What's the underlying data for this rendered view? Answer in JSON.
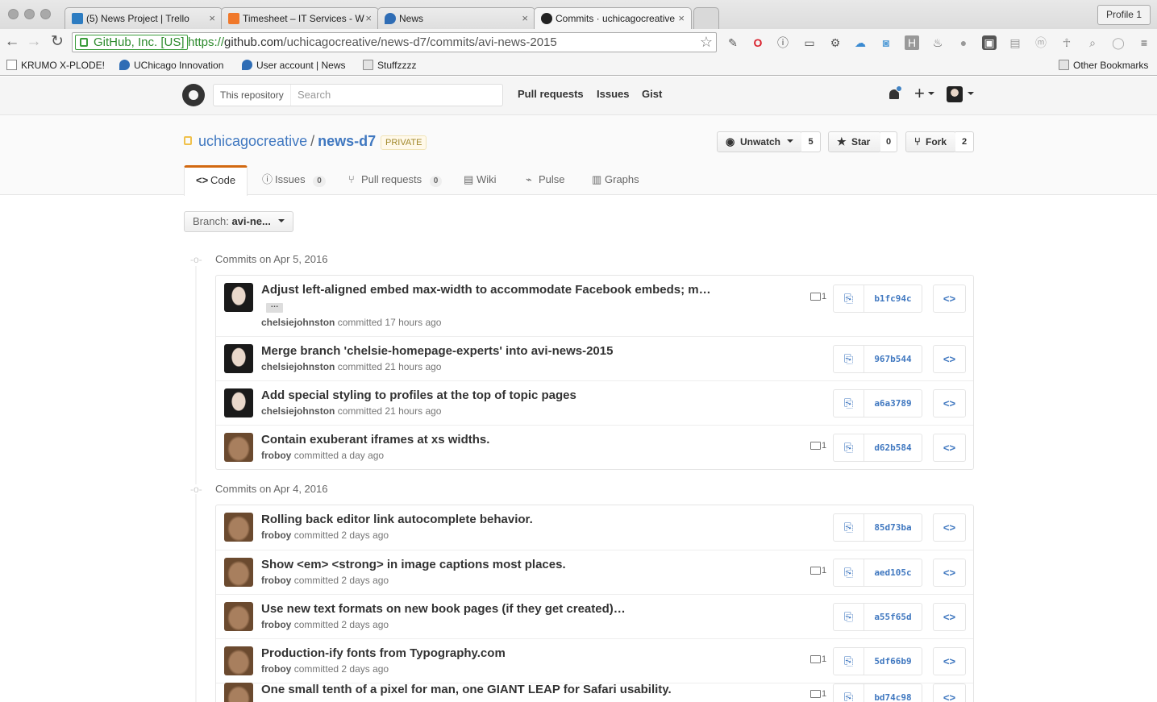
{
  "browser": {
    "tabs": [
      {
        "title": "(5) News Project | Trello",
        "favicon_color": "#2d7cc1",
        "active": false
      },
      {
        "title": "Timesheet – IT Services - W",
        "favicon_color": "#f0782a",
        "active": false
      },
      {
        "title": "News",
        "favicon_color": "#2f6db5",
        "active": false
      },
      {
        "title": "Commits · uchicagocreative",
        "favicon_color": "#222222",
        "active": true
      }
    ],
    "close_glyph": "×",
    "profile_label": "Profile 1",
    "ssl_label": "GitHub, Inc. [US]",
    "url_scheme": "https://",
    "url_host": "github.com",
    "url_path": "/uchicagocreative/news-d7/commits/avi-news-2015",
    "bookmarks": [
      "KRUMO X-PLODE!",
      "UChicago Innovation",
      "User account | News",
      "Stuffzzzz"
    ],
    "other_bookmarks": "Other Bookmarks"
  },
  "header": {
    "search_scope": "This repository",
    "search_placeholder": "Search",
    "nav": [
      "Pull requests",
      "Issues",
      "Gist"
    ]
  },
  "repo": {
    "owner": "uchicagocreative",
    "separator": "/",
    "name": "news-d7",
    "visibility": "PRIVATE",
    "unwatch_label": "Unwatch",
    "watch_count": "5",
    "star_label": "Star",
    "star_count": "0",
    "fork_label": "Fork",
    "fork_count": "2",
    "tabs": [
      {
        "label": "Code",
        "icon": "code-icon"
      },
      {
        "label": "Issues",
        "count": "0",
        "icon": "issue-icon"
      },
      {
        "label": "Pull requests",
        "count": "0",
        "icon": "pull-request-icon"
      },
      {
        "label": "Wiki",
        "icon": "book-icon"
      },
      {
        "label": "Pulse",
        "icon": "pulse-icon"
      },
      {
        "label": "Graphs",
        "icon": "graph-icon"
      }
    ],
    "branch_prefix": "Branch:",
    "branch_name": "avi-ne..."
  },
  "commit_groups": [
    {
      "date_label": "Commits on Apr 5, 2016",
      "commits": [
        {
          "title": "Adjust left-aligned embed max-width to accommodate Facebook embeds; m…",
          "author": "chelsiejohnston",
          "verb": "committed",
          "time": "17 hours ago",
          "comments": "1",
          "sha": "b1fc94c",
          "expand": "…"
        },
        {
          "title": "Merge branch 'chelsie-homepage-experts' into avi-news-2015",
          "author": "chelsiejohnston",
          "verb": "committed",
          "time": "21 hours ago",
          "comments": "",
          "sha": "967b544"
        },
        {
          "title": "Add special styling to profiles at the top of topic pages",
          "author": "chelsiejohnston",
          "verb": "committed",
          "time": "21 hours ago",
          "comments": "",
          "sha": "a6a3789"
        },
        {
          "title": "Contain exuberant iframes at xs widths.",
          "author": "froboy",
          "verb": "committed",
          "time": "a day ago",
          "comments": "1",
          "sha": "d62b584"
        }
      ]
    },
    {
      "date_label": "Commits on Apr 4, 2016",
      "commits": [
        {
          "title": "Rolling back editor link autocomplete behavior.",
          "author": "froboy",
          "verb": "committed",
          "time": "2 days ago",
          "comments": "",
          "sha": "85d73ba"
        },
        {
          "title": "Show <em> <strong> in image captions most places.",
          "author": "froboy",
          "verb": "committed",
          "time": "2 days ago",
          "comments": "1",
          "sha": "aed105c"
        },
        {
          "title": "Use new text formats on new book pages (if they get created)…",
          "author": "froboy",
          "verb": "committed",
          "time": "2 days ago",
          "comments": "",
          "sha": "a55f65d"
        },
        {
          "title": "Production-ify fonts from Typography.com",
          "author": "froboy",
          "verb": "committed",
          "time": "2 days ago",
          "comments": "1",
          "sha": "5df66b9"
        },
        {
          "title": "One small tenth of a pixel for man, one GIANT LEAP for Safari usability.",
          "author": "",
          "verb": "",
          "time": "",
          "comments": "1",
          "sha": "bd74c98"
        }
      ]
    }
  ]
}
